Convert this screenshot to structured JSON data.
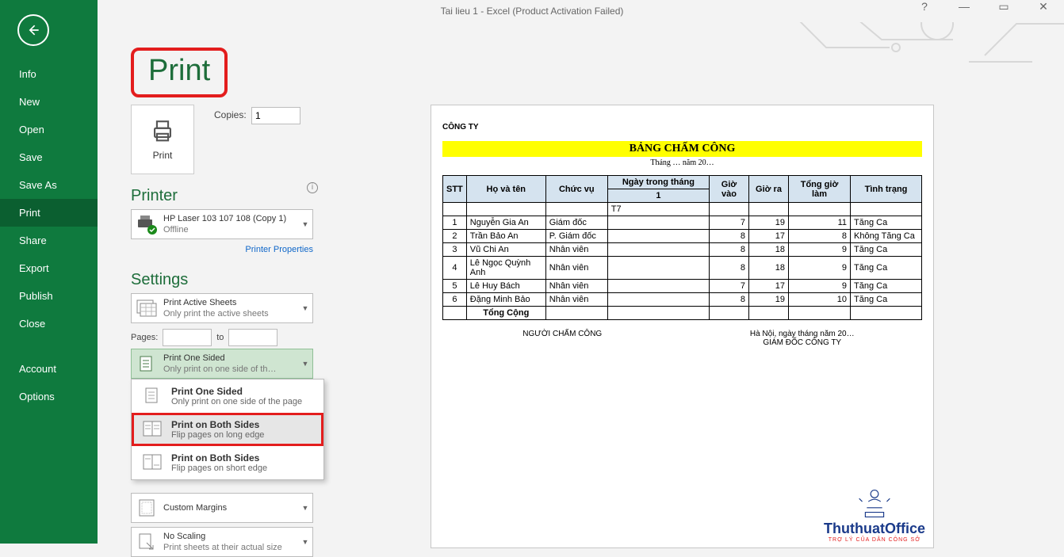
{
  "window": {
    "title": "Tai lieu 1 - Excel (Product Activation Failed)"
  },
  "nav": {
    "items": [
      "Info",
      "New",
      "Open",
      "Save",
      "Save As",
      "Print",
      "Share",
      "Export",
      "Publish",
      "Close"
    ],
    "bottom": [
      "Account",
      "Options"
    ],
    "active": "Print"
  },
  "heading": "Print",
  "print_button": "Print",
  "copies": {
    "label": "Copies:",
    "value": "1"
  },
  "printer": {
    "section": "Printer",
    "name": "HP Laser 103 107 108 (Copy 1)",
    "status": "Offline",
    "props_link": "Printer Properties"
  },
  "settings": {
    "section": "Settings",
    "active_sheets": {
      "title": "Print Active Sheets",
      "sub": "Only print the active sheets"
    },
    "pages": {
      "label": "Pages:",
      "to": "to",
      "from": "",
      "to_val": ""
    },
    "sided": {
      "title": "Print One Sided",
      "sub": "Only print on one side of th…"
    },
    "dropdown": [
      {
        "title": "Print One Sided",
        "sub": "Only print on one side of the page"
      },
      {
        "title": "Print on Both Sides",
        "sub": "Flip pages on long edge"
      },
      {
        "title": "Print on Both Sides",
        "sub": "Flip pages on short edge"
      }
    ],
    "margins": "Custom Margins",
    "scaling": {
      "title": "No Scaling",
      "sub": "Print sheets at their actual size"
    }
  },
  "preview": {
    "company": "CÔNG TY",
    "banner": "BẢNG CHẤM CÔNG",
    "sub": "Tháng … năm 20…",
    "headers": {
      "stt": "STT",
      "name": "Họ và tên",
      "role": "Chức vụ",
      "day_group": "Ngày trong tháng",
      "day": "1",
      "in": "Giờ vào",
      "out": "Giờ ra",
      "total": "Tổng giờ làm",
      "status": "Tình trạng"
    },
    "t7": "T7",
    "rows": [
      {
        "i": "1",
        "name": "Nguyễn Gia An",
        "role": "Giám đốc",
        "in": "7",
        "out": "19",
        "tot": "11",
        "st": "Tăng Ca"
      },
      {
        "i": "2",
        "name": "Trần Bảo An",
        "role": "P. Giám đốc",
        "in": "8",
        "out": "17",
        "tot": "8",
        "st": "Không Tăng Ca"
      },
      {
        "i": "3",
        "name": "Vũ Chi An",
        "role": "Nhân viên",
        "in": "8",
        "out": "18",
        "tot": "9",
        "st": "Tăng Ca"
      },
      {
        "i": "4",
        "name": "Lê Ngọc Quỳnh Anh",
        "role": "Nhân viên",
        "in": "8",
        "out": "18",
        "tot": "9",
        "st": "Tăng Ca"
      },
      {
        "i": "5",
        "name": "Lê Huy Bách",
        "role": "Nhân viên",
        "in": "7",
        "out": "17",
        "tot": "9",
        "st": "Tăng Ca"
      },
      {
        "i": "6",
        "name": "Đặng Minh Bảo",
        "role": "Nhân viên",
        "in": "8",
        "out": "19",
        "tot": "10",
        "st": "Tăng Ca"
      }
    ],
    "total_label": "Tổng Cộng",
    "footer": {
      "left": "NGƯỜI CHẤM CÔNG",
      "right_date": "Hà Nội, ngày       tháng       năm 20…",
      "right_sig": "GIÁM ĐỐC CÔNG TY"
    }
  },
  "watermark": {
    "line1": "ThuthuatOffice",
    "line2": "TRỢ LÝ CỦA DÂN CÔNG SỞ"
  }
}
